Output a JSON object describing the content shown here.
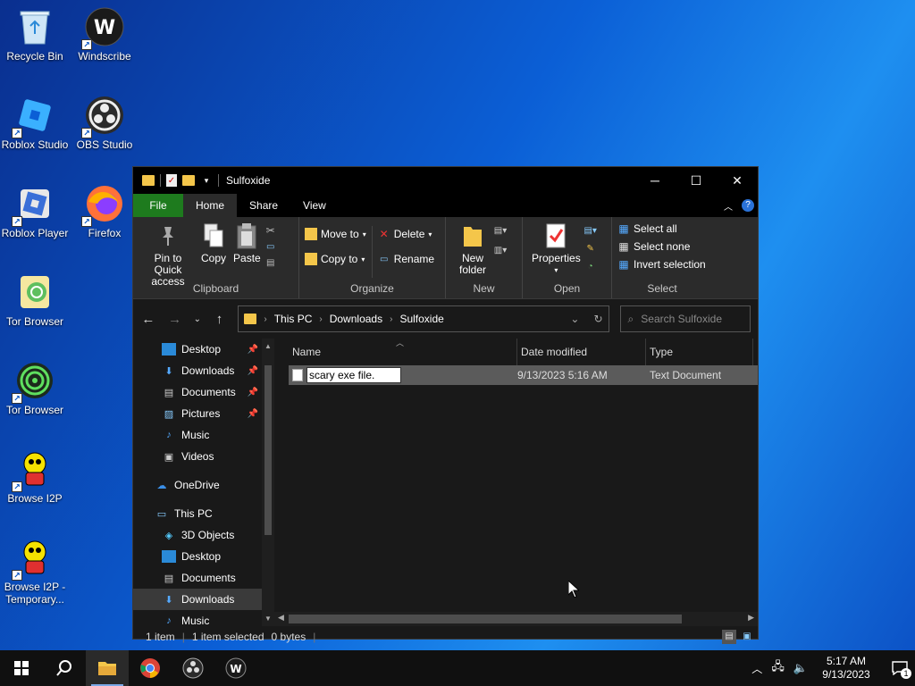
{
  "desktop": {
    "icons": [
      {
        "label": "Recycle Bin"
      },
      {
        "label": "Windscribe"
      },
      {
        "label": "Roblox Studio"
      },
      {
        "label": "OBS Studio"
      },
      {
        "label": "Roblox Player"
      },
      {
        "label": "Firefox"
      },
      {
        "label": "Tor Browser"
      },
      {
        "label": "Tor Browser"
      },
      {
        "label": "Browse I2P"
      },
      {
        "label": "Browse I2P - Temporary..."
      }
    ]
  },
  "window": {
    "title": "Sulfoxide",
    "tabs": {
      "file": "File",
      "home": "Home",
      "share": "Share",
      "view": "View"
    },
    "ribbon": {
      "clipboard": {
        "label": "Clipboard",
        "pin": "Pin to Quick access",
        "copy": "Copy",
        "paste": "Paste"
      },
      "organize": {
        "label": "Organize",
        "move_to": "Move to",
        "copy_to": "Copy to",
        "delete": "Delete",
        "rename": "Rename"
      },
      "new": {
        "label": "New",
        "new_folder": "New folder"
      },
      "open": {
        "label": "Open",
        "properties": "Properties"
      },
      "select": {
        "label": "Select",
        "select_all": "Select all",
        "select_none": "Select none",
        "invert": "Invert selection"
      }
    },
    "address": {
      "crumbs": [
        "This PC",
        "Downloads",
        "Sulfoxide"
      ],
      "search_placeholder": "Search Sulfoxide"
    },
    "nav": {
      "quick": [
        {
          "label": "Desktop"
        },
        {
          "label": "Downloads"
        },
        {
          "label": "Documents"
        },
        {
          "label": "Pictures"
        },
        {
          "label": "Music"
        },
        {
          "label": "Videos"
        }
      ],
      "onedrive": "OneDrive",
      "thispc": "This PC",
      "pc_items": [
        {
          "label": "3D Objects"
        },
        {
          "label": "Desktop"
        },
        {
          "label": "Documents"
        },
        {
          "label": "Downloads"
        },
        {
          "label": "Music"
        }
      ]
    },
    "columns": {
      "name": "Name",
      "date": "Date modified",
      "type": "Type"
    },
    "files": [
      {
        "name": "scary exe file.",
        "date": "9/13/2023 5:16 AM",
        "type": "Text Document"
      }
    ],
    "status": {
      "count": "1 item",
      "selected": "1 item selected",
      "size": "0 bytes"
    }
  },
  "taskbar": {
    "time": "5:17 AM",
    "date": "9/13/2023",
    "notification_count": "1"
  }
}
